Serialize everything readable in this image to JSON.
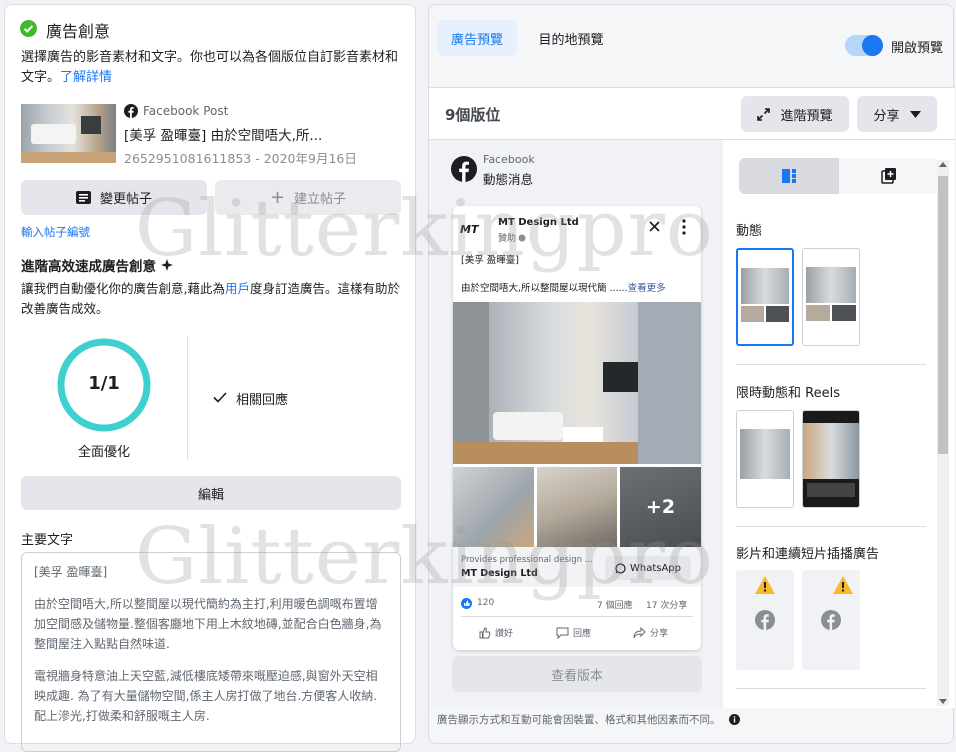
{
  "left": {
    "section_title": "廣告創意",
    "description": "選擇廣告的影音素材和文字。你也可以為各個版位自訂影音素材和文字。",
    "learn_more": "了解詳情",
    "post": {
      "source": "Facebook Post",
      "title": "[美孚 盈暉臺] 由於空間唔大,所...",
      "meta": "2652951081611853 - 2020年9月16日"
    },
    "change_post": "變更帖子",
    "create_post": "建立帖子",
    "enter_post_id": "輸入帖子編號",
    "advantage": {
      "title": "進階高效速成廣告創意",
      "text_before": "讓我們自動優化你的廣告創意,藉此為",
      "link": "用戶",
      "text_after": "度身訂造廣告。這樣有助於改善廣告成效。",
      "progress_value": "1/1",
      "progress_fraction": 1.0,
      "progress_label": "全面優化",
      "related": "相關回應"
    },
    "edit_button": "編輯",
    "primary_text_label": "主要文字",
    "primary_text": {
      "line1": "[美孚 盈暉臺]",
      "line2": "由於空間唔大,所以整間屋以現代簡約為主打,利用暖色調嘅布置增加空間感及儲物量.整個客廳地下用上木紋地磚,並配合白色牆身,為整間屋注入點點自然味道.",
      "line3": "電視牆身特意油上天空藍,減低樓底矮帶來嘅壓迫感,與窗外天空相映成趣. 為了有大量儲物空間,係主人房打做了地台.方便客人收納.配上滲光,打做柔和舒服嘅主人房."
    }
  },
  "right": {
    "tab_ad_preview": "廣告預覽",
    "tab_destination": "目的地預覽",
    "toggle_label": "開啟預覽",
    "toggle_on": true,
    "placements_count": "9個版位",
    "advanced_preview": "進階預覽",
    "share": "分享",
    "platform_name": "Facebook",
    "placement_name": "動態消息",
    "ad": {
      "page_name": "MT Design Ltd",
      "sponsored": "贊助",
      "logo_text": "MT",
      "line1": "[美孚 盈暉臺]",
      "line2": "由於空間唔大,所以整間屋以現代簡 ......",
      "see_more": "查看更多",
      "extra_photos": "+2",
      "link_desc": "Provides professional design ...",
      "link_title": "MT Design Ltd",
      "cta": "WhatsApp",
      "reactions": "120",
      "comments": "7 個回應",
      "shares": "17 次分享",
      "like": "讚好",
      "comment": "回應",
      "share": "分享"
    },
    "view_version": "查看版本",
    "groups": [
      {
        "title": "動態"
      },
      {
        "title": "限時動態和 Reels"
      },
      {
        "title": "影片和連續短片插播廣告"
      }
    ],
    "footer_note": "廣告顯示方式和互動可能會因裝置、格式和其他因素而不同。",
    "colors": {
      "accent": "#1877f2",
      "teal": "#3ecfcf",
      "warning": "#f7b928"
    }
  },
  "watermarks": [
    "Glitterkingpro",
    "Glitterkingpro"
  ]
}
